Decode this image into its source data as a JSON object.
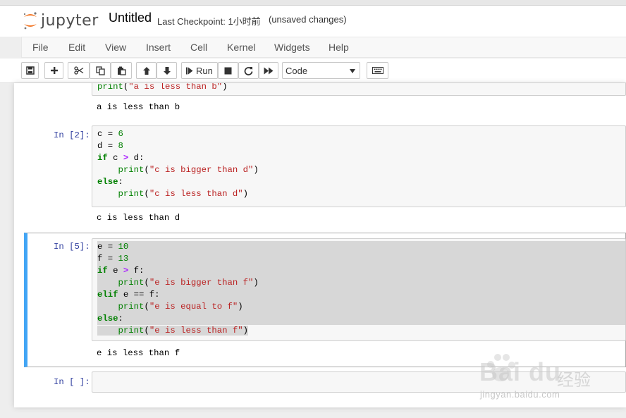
{
  "header": {
    "logo_text": "jupyter",
    "notebook_title": "Untitled",
    "checkpoint": "Last Checkpoint: 1小时前",
    "unsaved": "(unsaved changes)"
  },
  "menu": [
    "File",
    "Edit",
    "View",
    "Insert",
    "Cell",
    "Kernel",
    "Widgets",
    "Help"
  ],
  "toolbar": {
    "run_label": "Run",
    "cell_type": "Code",
    "icons": [
      "save-icon",
      "plus-icon",
      "scissors-icon",
      "copy-icon",
      "paste-icon",
      "arrow-up-icon",
      "arrow-down-icon",
      "run-icon",
      "stop-icon",
      "restart-icon",
      "fast-forward-icon",
      "keyboard-icon"
    ]
  },
  "cells": [
    {
      "prompt": "",
      "code_line": "print(\"a is less than b\")",
      "output": "a is less than b"
    },
    {
      "prompt": "In [2]:",
      "output": "c is less than d"
    },
    {
      "prompt": "In [5]:",
      "output": "e is less than f"
    },
    {
      "prompt": "In [ ]:"
    }
  ],
  "watermark": {
    "brand": "Bai du",
    "cn": "经验",
    "url": "jingyan.baidu.com"
  },
  "colors": {
    "prompt": "#303f9f",
    "keyword": "#008000",
    "string": "#ba2121",
    "operator": "#aa22ff",
    "selected_cell_bar": "#42a5f5"
  }
}
